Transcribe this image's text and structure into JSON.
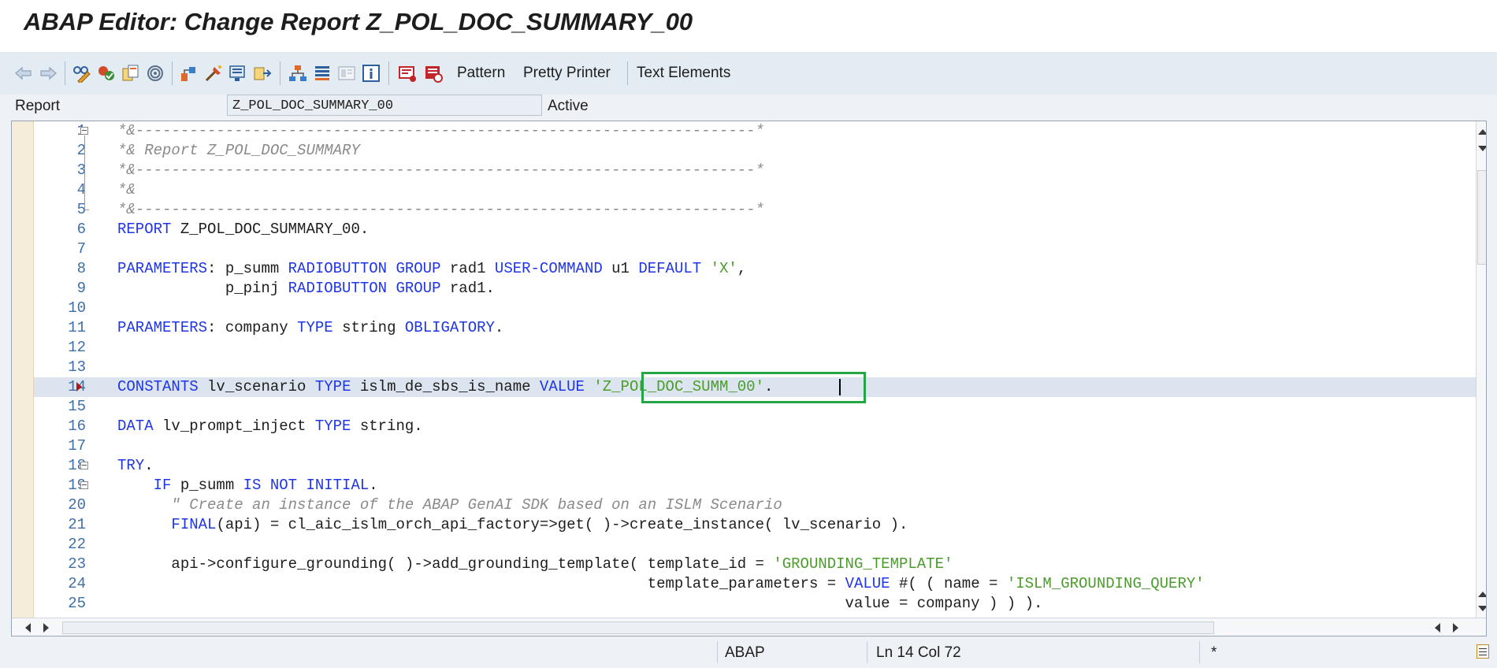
{
  "window": {
    "title": "ABAP Editor: Change Report Z_POL_DOC_SUMMARY_00"
  },
  "toolbar": {
    "icons": [
      "back-arrow-icon",
      "forward-arrow-icon",
      "glasses-pencil-icon",
      "check-syntax-icon",
      "copy-objects-icon",
      "spiral-icon",
      "where-used-icon",
      "activate-icon",
      "display-object-icon",
      "move-object-icon",
      "hierarchy-icon",
      "stack-icon",
      "layout-icon",
      "info-icon",
      "transport-icon",
      "error-log-icon"
    ],
    "pattern_label": "Pattern",
    "pretty_printer_label": "Pretty Printer",
    "text_elements_label": "Text Elements"
  },
  "report": {
    "label": "Report",
    "name": "Z_POL_DOC_SUMMARY_00",
    "status": "Active"
  },
  "editor": {
    "current_line": 14,
    "lines": [
      {
        "num": "1",
        "tokens": [
          [
            "cm",
            "*&---------------------------------------------------------------------*"
          ]
        ]
      },
      {
        "num": "2",
        "tokens": [
          [
            "cm",
            "*& Report Z_POL_DOC_SUMMARY"
          ]
        ]
      },
      {
        "num": "3",
        "tokens": [
          [
            "cm",
            "*&---------------------------------------------------------------------*"
          ]
        ]
      },
      {
        "num": "4",
        "tokens": [
          [
            "cm",
            "*&"
          ]
        ]
      },
      {
        "num": "5",
        "tokens": [
          [
            "cm",
            "*&---------------------------------------------------------------------*"
          ]
        ]
      },
      {
        "num": "6",
        "tokens": [
          [
            "kw",
            "REPORT"
          ],
          [
            "id",
            " Z_POL_DOC_SUMMARY_00"
          ],
          [
            "pun",
            "."
          ]
        ]
      },
      {
        "num": "7",
        "tokens": []
      },
      {
        "num": "8",
        "tokens": [
          [
            "kw",
            "PARAMETERS"
          ],
          [
            "pun",
            ":"
          ],
          [
            "id",
            " p_summ "
          ],
          [
            "kw",
            "RADIOBUTTON GROUP"
          ],
          [
            "id",
            " rad1 "
          ],
          [
            "kw",
            "USER-COMMAND"
          ],
          [
            "id",
            " u1 "
          ],
          [
            "kw",
            "DEFAULT"
          ],
          [
            "id",
            " "
          ],
          [
            "str",
            "'X'"
          ],
          [
            "pun",
            ","
          ]
        ]
      },
      {
        "num": "9",
        "tokens": [
          [
            "id",
            "            p_pinj "
          ],
          [
            "kw",
            "RADIOBUTTON GROUP"
          ],
          [
            "id",
            " rad1"
          ],
          [
            "pun",
            "."
          ]
        ]
      },
      {
        "num": "10",
        "tokens": []
      },
      {
        "num": "11",
        "tokens": [
          [
            "kw",
            "PARAMETERS"
          ],
          [
            "pun",
            ":"
          ],
          [
            "id",
            " company "
          ],
          [
            "kw",
            "TYPE"
          ],
          [
            "id",
            " string "
          ],
          [
            "kw",
            "OBLIGATORY"
          ],
          [
            "pun",
            "."
          ]
        ]
      },
      {
        "num": "12",
        "tokens": []
      },
      {
        "num": "13",
        "tokens": []
      },
      {
        "num": "14",
        "tokens": [
          [
            "kw",
            "CONSTANTS"
          ],
          [
            "id",
            " lv_scenario "
          ],
          [
            "kw",
            "TYPE"
          ],
          [
            "id",
            " islm_de_sbs_is_name "
          ],
          [
            "kw",
            "VALUE"
          ],
          [
            "id",
            " "
          ],
          [
            "str",
            "'Z_POL_DOC_SUMM_00'"
          ],
          [
            "pun",
            "."
          ]
        ]
      },
      {
        "num": "15",
        "tokens": []
      },
      {
        "num": "16",
        "tokens": [
          [
            "kw",
            "DATA"
          ],
          [
            "id",
            " lv_prompt_inject "
          ],
          [
            "kw",
            "TYPE"
          ],
          [
            "id",
            " string"
          ],
          [
            "pun",
            "."
          ]
        ]
      },
      {
        "num": "17",
        "tokens": []
      },
      {
        "num": "18",
        "tokens": [
          [
            "kw",
            "TRY"
          ],
          [
            "pun",
            "."
          ]
        ]
      },
      {
        "num": "19",
        "tokens": [
          [
            "id",
            "    "
          ],
          [
            "kw",
            "IF"
          ],
          [
            "id",
            " p_summ "
          ],
          [
            "kw",
            "IS NOT INITIAL"
          ],
          [
            "pun",
            "."
          ]
        ]
      },
      {
        "num": "20",
        "tokens": [
          [
            "id",
            "      "
          ],
          [
            "cm",
            "\" Create an instance of the ABAP GenAI SDK based on an ISLM Scenario"
          ]
        ]
      },
      {
        "num": "21",
        "tokens": [
          [
            "id",
            "      "
          ],
          [
            "kw",
            "FINAL"
          ],
          [
            "pun",
            "("
          ],
          [
            "id",
            "api"
          ],
          [
            "pun",
            ")"
          ],
          [
            "id",
            " = cl_aic_islm_orch_api_factory=>get( )->create_instance( lv_scenario )"
          ],
          [
            "pun",
            "."
          ]
        ]
      },
      {
        "num": "22",
        "tokens": []
      },
      {
        "num": "23",
        "tokens": [
          [
            "id",
            "      api->configure_grounding( )->add_grounding_template( template_id = "
          ],
          [
            "str",
            "'GROUNDING_TEMPLATE'"
          ]
        ]
      },
      {
        "num": "24",
        "tokens": [
          [
            "id",
            "                                                           template_parameters = "
          ],
          [
            "kw",
            "VALUE"
          ],
          [
            "id",
            " #( ( name = "
          ],
          [
            "str",
            "'ISLM_GROUNDING_QUERY'"
          ]
        ]
      },
      {
        "num": "25",
        "tokens": [
          [
            "id",
            "                                                                                 value = company ) ) )"
          ],
          [
            "pun",
            "."
          ]
        ]
      }
    ]
  },
  "status_bar": {
    "language": "ABAP",
    "position": "Ln  14 Col  72",
    "modified_marker": "*"
  }
}
